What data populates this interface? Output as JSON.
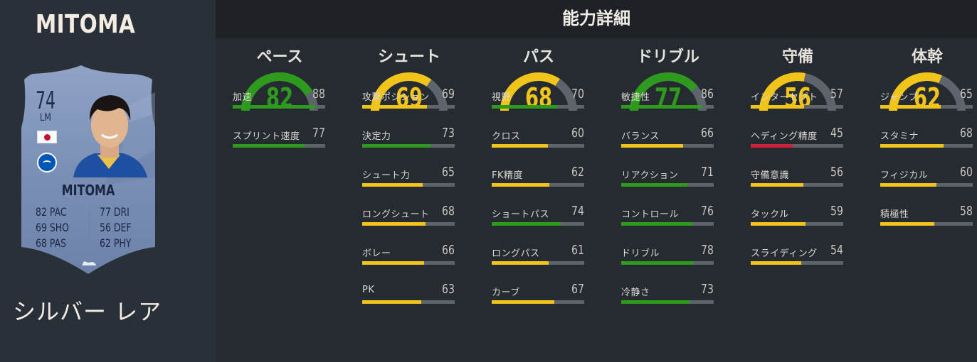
{
  "player": {
    "name": "MITOMA",
    "card": {
      "rating": "74",
      "position": "LM",
      "name": "MITOMA",
      "stats_left": [
        [
          "82",
          "PAC"
        ],
        [
          "69",
          "SHO"
        ],
        [
          "68",
          "PAS"
        ]
      ],
      "stats_right": [
        [
          "77",
          "DRI"
        ],
        [
          "56",
          "DEF"
        ],
        [
          "62",
          "PHY"
        ]
      ]
    },
    "card_type": "シルバー レア"
  },
  "header": {
    "title": "能力詳細"
  },
  "colors": {
    "green": "#2e9a1e",
    "yellow": "#f0c419",
    "red": "#d0203a",
    "track": "#5d646c"
  },
  "categories": [
    {
      "title": "ペース",
      "value": 82,
      "stats": [
        {
          "label": "加速",
          "value": 88
        },
        {
          "label": "スプリント速度",
          "value": 77
        }
      ]
    },
    {
      "title": "シュート",
      "value": 69,
      "stats": [
        {
          "label": "攻撃ポジション",
          "value": 69
        },
        {
          "label": "決定力",
          "value": 73
        },
        {
          "label": "シュート力",
          "value": 65
        },
        {
          "label": "ロングシュート",
          "value": 68
        },
        {
          "label": "ボレー",
          "value": 66
        },
        {
          "label": "PK",
          "value": 63
        }
      ]
    },
    {
      "title": "パス",
      "value": 68,
      "stats": [
        {
          "label": "視野",
          "value": 70
        },
        {
          "label": "クロス",
          "value": 60
        },
        {
          "label": "FK精度",
          "value": 62
        },
        {
          "label": "ショートパス",
          "value": 74
        },
        {
          "label": "ロングパス",
          "value": 61
        },
        {
          "label": "カーブ",
          "value": 67
        }
      ]
    },
    {
      "title": "ドリブル",
      "value": 77,
      "stats": [
        {
          "label": "敏捷性",
          "value": 86
        },
        {
          "label": "バランス",
          "value": 66
        },
        {
          "label": "リアクション",
          "value": 71
        },
        {
          "label": "コントロール",
          "value": 76
        },
        {
          "label": "ドリブル",
          "value": 78
        },
        {
          "label": "冷静さ",
          "value": 73
        }
      ]
    },
    {
      "title": "守備",
      "value": 56,
      "stats": [
        {
          "label": "インターセプト",
          "value": 57
        },
        {
          "label": "ヘディング精度",
          "value": 45
        },
        {
          "label": "守備意識",
          "value": 56
        },
        {
          "label": "タックル",
          "value": 59
        },
        {
          "label": "スライディング",
          "value": 54
        }
      ]
    },
    {
      "title": "体幹",
      "value": 62,
      "stats": [
        {
          "label": "ジャンプ",
          "value": 65
        },
        {
          "label": "スタミナ",
          "value": 68
        },
        {
          "label": "フィジカル",
          "value": 60
        },
        {
          "label": "積極性",
          "value": 58
        }
      ]
    }
  ]
}
